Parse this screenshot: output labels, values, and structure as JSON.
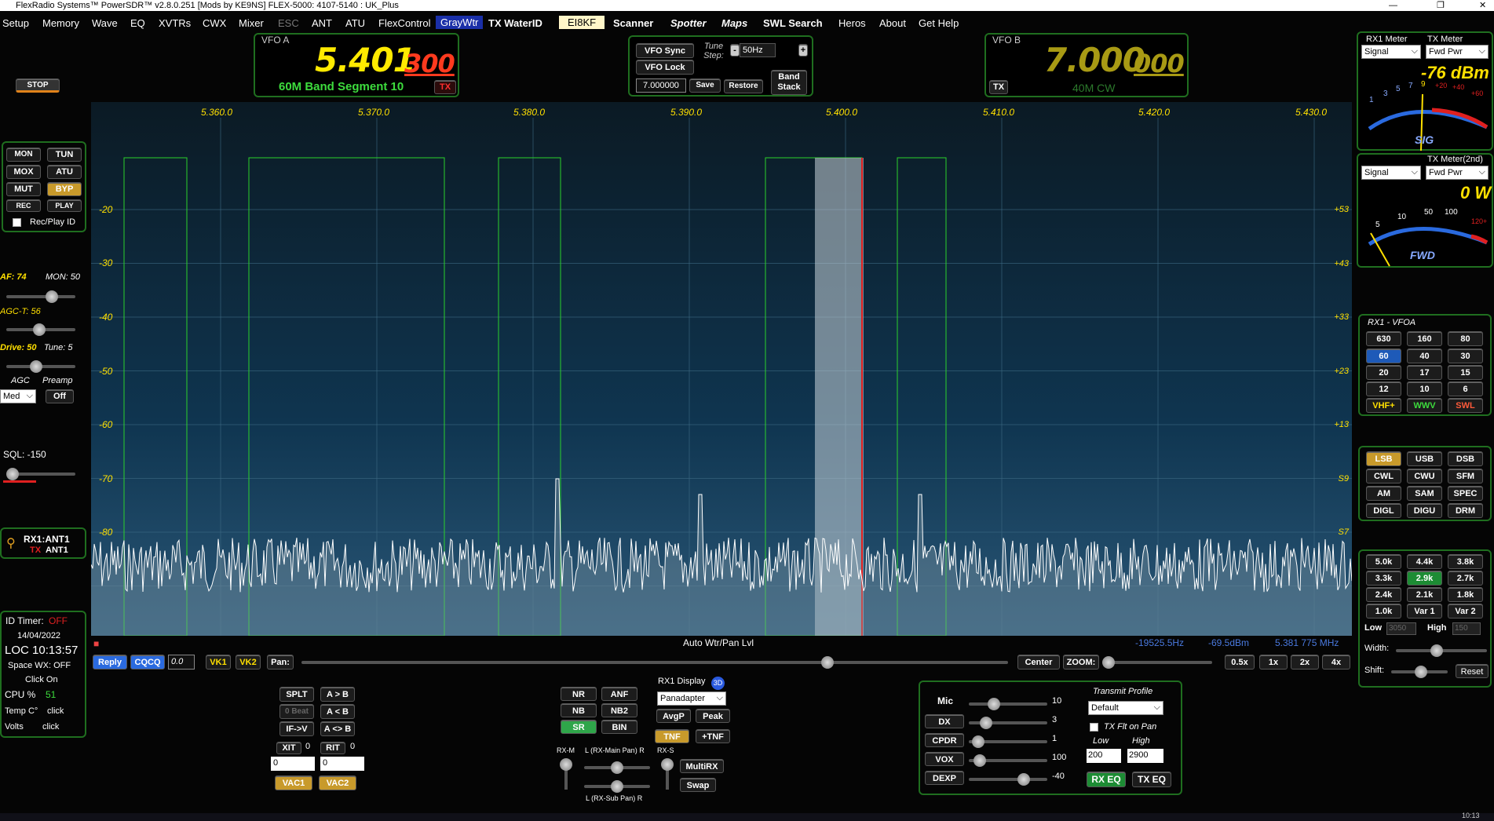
{
  "title": "FlexRadio Systems™  PowerSDR™  v2.8.0.251  [Mods by KE9NS]   FLEX-5000: 4107-5140 : UK_Plus",
  "window_controls": [
    "—",
    "❐",
    "✕"
  ],
  "menu": [
    "Setup",
    "Memory",
    "Wave",
    "EQ",
    "XVTRs",
    "CWX",
    "Mixer",
    "ESC",
    "ANT",
    "ATU",
    "FlexControl",
    "GrayWtr",
    "TX WaterID",
    "EI8KF",
    "Scanner",
    "Spotter",
    "Maps",
    "SWL Search",
    "Heros",
    "About",
    "Get Help"
  ],
  "vfo_a": {
    "label": "VFO A",
    "freq_main": "5.401",
    "freq_sub": "300",
    "band": "60M Band Segment 10",
    "tx": "TX"
  },
  "vfo_b": {
    "label": "VFO B",
    "freq_main": "7.000",
    "freq_sub": "000",
    "band": "40M CW",
    "tx": "TX"
  },
  "vfo_ctl": {
    "sync": "VFO Sync",
    "lock": "VFO Lock",
    "tune_step_label": "Tune Step:",
    "tune_step": "50Hz",
    "minus": "-",
    "plus": "+",
    "memfreq": "7.000000",
    "save": "Save",
    "restore": "Restore",
    "band_stack": "Band Stack"
  },
  "stop": "STOP",
  "left_buttons": {
    "mon": "MON",
    "tun": "TUN",
    "mox": "MOX",
    "atu": "ATU",
    "mut": "MUT",
    "byp": "BYP",
    "rec": "REC",
    "play": "PLAY",
    "recplay": "Rec/Play ID"
  },
  "levels": {
    "af": "AF: 74",
    "mon": "MON: 50",
    "agct": "AGC-T:  56",
    "drive": "Drive: 50",
    "tune": "Tune: 5",
    "agc": "AGC",
    "preamp": "Preamp",
    "agc_val": "Med",
    "preamp_val": "Off",
    "sql": "SQL:  -150"
  },
  "ant": {
    "rx": "RX1:ANT1",
    "tx_label": "TX",
    "tx": "ANT1"
  },
  "status": {
    "id_timer_label": "ID Timer:",
    "id_timer": "OFF",
    "date": "14/04/2022",
    "loc": "LOC  10:13:57",
    "wx": "Space WX: OFF",
    "click_on": "Click On",
    "cpu_label": "CPU %",
    "cpu": "51",
    "temp_label": "Temp C°",
    "temp": "click",
    "volts_label": "Volts",
    "volts": "click"
  },
  "meters": {
    "rx1_label": "RX1 Meter",
    "tx_label": "TX Meter",
    "rx1_sel": "Signal",
    "tx_sel": "Fwd Pwr",
    "reading": "-76 dBm",
    "tx2_label": "TX Meter(2nd)",
    "tx2_sel1": "Signal",
    "tx2_sel2": "Fwd Pwr",
    "tx2_reading": "0 W",
    "sig": "SIG",
    "fwd": "FWD",
    "sig_scale": [
      "1",
      "3",
      "5",
      "7",
      "9",
      "+20",
      "+40",
      "+60"
    ],
    "fwd_scale": [
      "5",
      "10",
      "50",
      "100",
      "120+"
    ]
  },
  "band": {
    "label": "RX1 - VFOA",
    "buttons": [
      "630",
      "160",
      "80",
      "60",
      "40",
      "30",
      "20",
      "17",
      "15",
      "12",
      "10",
      "6",
      "VHF+",
      "WWV",
      "SWL"
    ]
  },
  "mode": {
    "buttons": [
      "LSB",
      "USB",
      "DSB",
      "CWL",
      "CWU",
      "SFM",
      "AM",
      "SAM",
      "SPEC",
      "DIGL",
      "DIGU",
      "DRM"
    ]
  },
  "filter": {
    "buttons": [
      "5.0k",
      "4.4k",
      "3.8k",
      "3.3k",
      "2.9k",
      "2.7k",
      "2.4k",
      "2.1k",
      "1.8k",
      "1.0k",
      "Var 1",
      "Var 2"
    ],
    "low_label": "Low",
    "low": "3050",
    "high_label": "High",
    "high": "150",
    "width": "Width:",
    "shift": "Shift:",
    "reset": "Reset"
  },
  "pan": {
    "freq_labels": [
      "5.360.0",
      "5.370.0",
      "5.380.0",
      "5.390.0",
      "5.400.0",
      "5.410.0",
      "5.420.0",
      "5.430.0"
    ],
    "db_left": [
      "-20",
      "-30",
      "-40",
      "-50",
      "-60",
      "-70",
      "-80"
    ],
    "db_right": [
      "+53",
      "+43",
      "+33",
      "+23",
      "+13",
      "S9",
      "S7"
    ]
  },
  "pan_status": {
    "mode": "Auto Wtr/Pan Lvl",
    "offset": "-19525.5Hz",
    "level": "-69.5dBm",
    "freq": "5.381 775 MHz"
  },
  "pan_bar": {
    "reply": "Reply",
    "cqcq": "CQCQ",
    "num": "0.0",
    "vk1": "VK1",
    "vk2": "VK2",
    "pan": "Pan:",
    "center": "Center",
    "zoom": "ZOOM:",
    "z05": "0.5x",
    "z1": "1x",
    "z2": "2x",
    "z4": "4x"
  },
  "vfo_ops": {
    "splt": "SPLT",
    "a2b": "A > B",
    "zerobeat": "0 Beat",
    "b2a": "A < B",
    "ifv": "IF->V",
    "swap": "A <> B",
    "xit": "XIT",
    "xit_v": "0",
    "rit": "RIT",
    "rit_v": "0",
    "xit_num": "0",
    "rit_num": "0",
    "vac1": "VAC1",
    "vac2": "VAC2"
  },
  "dsp": {
    "nr": "NR",
    "anf": "ANF",
    "nb": "NB",
    "nb2": "NB2",
    "sr": "SR",
    "bin": "BIN",
    "rx1_display": "RX1 Display",
    "d3": "3D",
    "display_sel": "Panadapter",
    "avgp": "AvgP",
    "peak": "Peak",
    "tnf": "TNF",
    "ptnf": "+TNF",
    "rxm": "RX-M",
    "rxs": "RX-S",
    "mainpan": "L (RX-Main Pan) R",
    "subpan": "L (RX-Sub Pan) R",
    "multirx": "MultiRX",
    "swap": "Swap"
  },
  "tx": {
    "mic": "Mic",
    "mic_v": "10",
    "dx": "DX",
    "dx_v": "3",
    "cpdr": "CPDR",
    "cpdr_v": "1",
    "vox": "VOX",
    "vox_v": "100",
    "dexp": "DEXP",
    "dexp_v": "-40",
    "profile_label": "Transmit Profile",
    "profile": "Default",
    "txflt": "TX Flt on Pan",
    "low": "Low",
    "high": "High",
    "low_v": "200",
    "high_v": "2900",
    "rxeq": "RX EQ",
    "txeq": "TX EQ"
  },
  "taskbar_time": "10:13"
}
